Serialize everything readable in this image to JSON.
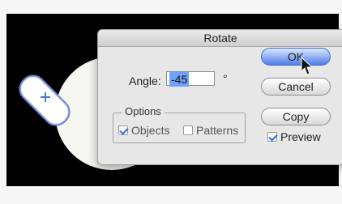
{
  "window": {
    "title": "Rotate"
  },
  "angle": {
    "label": "Angle:",
    "value": "-45",
    "unit": "°"
  },
  "options": {
    "title": "Options",
    "objects_label": "Objects",
    "objects_checked": true,
    "patterns_label": "Patterns",
    "patterns_checked": false
  },
  "buttons": {
    "ok": "OK",
    "cancel": "Cancel",
    "copy": "Copy"
  },
  "preview": {
    "label": "Preview",
    "checked": true
  },
  "icons": {
    "cursor": "pointer-arrow-icon",
    "center": "crosshair-center-icon"
  },
  "colors": {
    "accent": "#4e7de6",
    "selection": "#6fa2ff",
    "canvas": "#000000"
  }
}
